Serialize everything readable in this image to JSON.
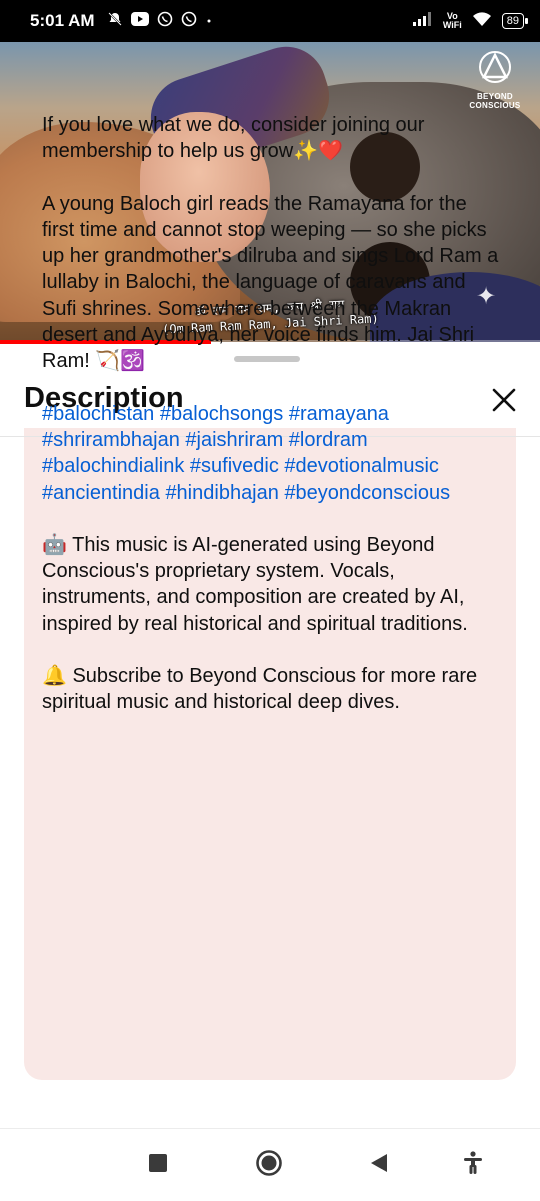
{
  "status_bar": {
    "time": "5:01 AM",
    "left_icons": [
      "alarm-off-icon",
      "youtube-icon",
      "whatsapp-icon",
      "whatsapp-icon",
      "dot-icon"
    ],
    "network_label_top": "Vo",
    "network_label_bottom": "WiFi",
    "battery": "89"
  },
  "video": {
    "channel_logo_text": "BEYOND CONSCIOUS",
    "subtitle_line1": "ॐ राम राम राम, जय श्री राम",
    "subtitle_line2": "(Om Ram Ram Ram, Jai Shri Ram)",
    "progress": 0.39
  },
  "description_sheet": {
    "title": "Description",
    "paragraphs": {
      "intro": "If you love what we do, consider joining our membership to help us grow✨❤️",
      "story": "A young Baloch girl reads the Ramayana for the first time and cannot stop weeping — so she picks up her grandmother's dilruba and sings Lord Ram a lullaby in Balochi, the language of caravans and Sufi shrines. Somewhere between the Makran desert and Ayodhya, her voice finds him. Jai Shri Ram! 🏹🕉️",
      "ai_note": "🤖 This music is AI-generated using Beyond Conscious's proprietary system. Vocals, instruments, and composition are created by AI, inspired by real historical and spiritual traditions.",
      "subscribe": "🔔 Subscribe to Beyond Conscious for more rare spiritual music and historical deep dives."
    },
    "hashtags": [
      "#balochistan",
      "#balochsongs",
      "#ramayana",
      "#shrirambhajan",
      "#jaishriram",
      "#lordram",
      "#balochindialink",
      "#sufivedic",
      "#devotionalmusic",
      "#ancientindia",
      "#hindibhajan",
      "#beyondconscious"
    ]
  },
  "nav_bar": {
    "buttons": [
      "recents-icon",
      "home-icon",
      "back-icon",
      "accessibility-icon"
    ]
  },
  "colors": {
    "card_background": "#f9e8e6",
    "hashtag_link": "#065fd4",
    "progress": "#ff0000"
  }
}
